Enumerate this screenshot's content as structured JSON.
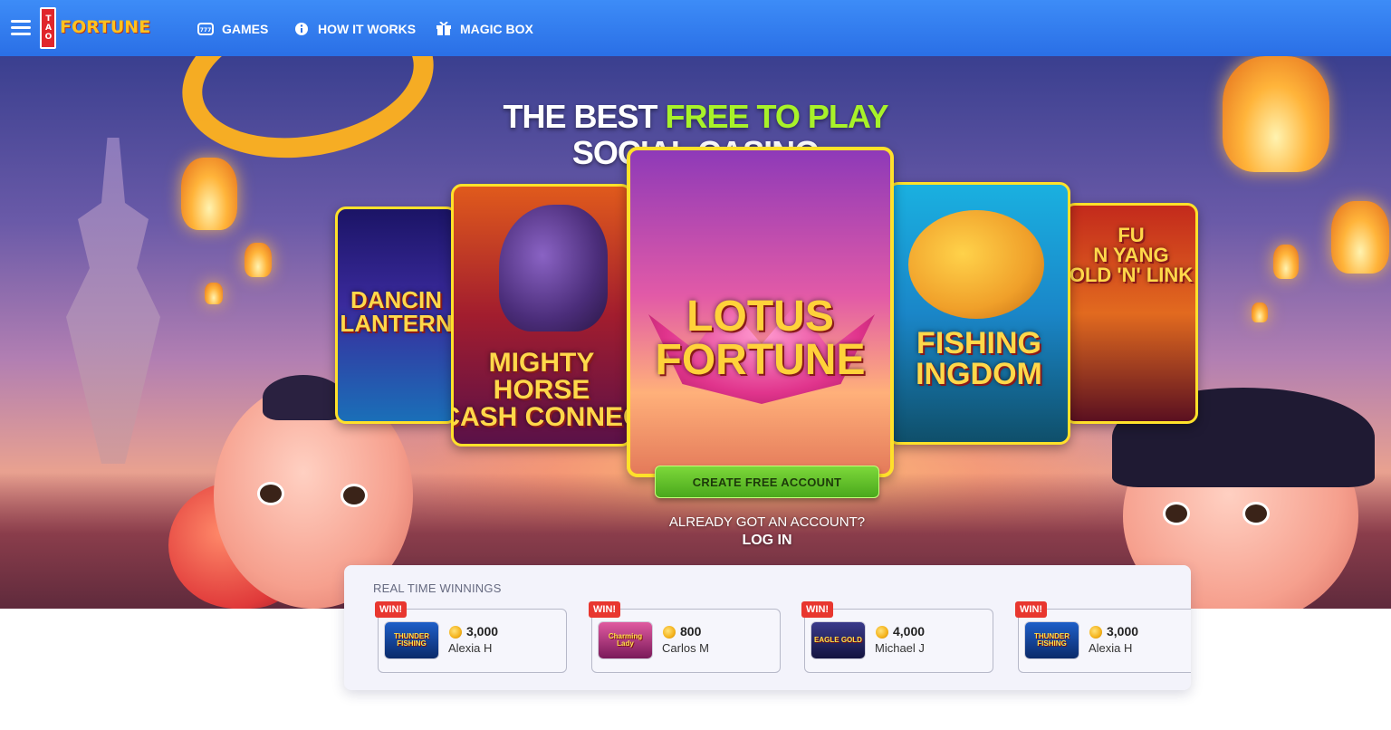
{
  "header": {
    "logo_tag": "TAO",
    "logo_word": "FORTUNE",
    "nav": [
      {
        "label": "GAMES",
        "icon": "slot-machine-icon"
      },
      {
        "label": "HOW IT WORKS",
        "icon": "info-icon"
      },
      {
        "label": "MAGIC BOX",
        "icon": "magic-box-icon"
      }
    ]
  },
  "hero": {
    "headline_part1": "THE BEST ",
    "headline_part2": "FREE TO PLAY",
    "headline_line2": "SOCIAL CASINO",
    "games": [
      {
        "title": "DANCIN\nLANTERN"
      },
      {
        "title": "MIGHTY\nHORSE\nCASH CONNEC"
      },
      {
        "title": "LOTUS\nFORTUNE"
      },
      {
        "title": "FISHING\nINGDOM"
      },
      {
        "title": "FU\nN YANG\nOLD 'N' LINK"
      }
    ],
    "cta_label": "CREATE FREE ACCOUNT",
    "already_text": "ALREADY GOT AN ACCOUNT?",
    "login_label": "LOG IN"
  },
  "winnings": {
    "title": "REAL TIME WINNINGS",
    "badge": "WIN!",
    "items": [
      {
        "game": "THUNDER\nFISHING",
        "amount": "3,000",
        "player": "Alexia H",
        "thumb_color": "#1f5fc8"
      },
      {
        "game": "Charming\nLady",
        "amount": "800",
        "player": "Carlos M",
        "thumb_color": "#c8448a"
      },
      {
        "game": "EAGLE GOLD",
        "amount": "4,000",
        "player": "Michael J",
        "thumb_color": "#2a2a6a"
      },
      {
        "game": "THUNDER\nFISHING",
        "amount": "3,000",
        "player": "Alexia H",
        "thumb_color": "#1f5fc8"
      }
    ]
  },
  "colors": {
    "nav_blue": "#2a6fe6",
    "accent_green": "#a8f229",
    "cta_green": "#4aa81c",
    "card_border": "#ffe12a",
    "win_red": "#e8372f"
  }
}
